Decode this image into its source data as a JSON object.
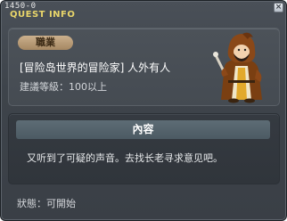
{
  "window": {
    "quest_id": "1450-0",
    "title": "QUEST INFO",
    "close_label": "×"
  },
  "quest": {
    "job_label": "職業",
    "name": "[冒险岛世界的冒险家] 人外有人",
    "level_requirement": "建議等級：100以上"
  },
  "content": {
    "header": "內容",
    "text": "又听到了可疑的声音。去找长老寻求意见吧。"
  },
  "status": {
    "text": "狀態：可開始"
  },
  "npc": {
    "icon": "hooded-mage-icon"
  }
}
